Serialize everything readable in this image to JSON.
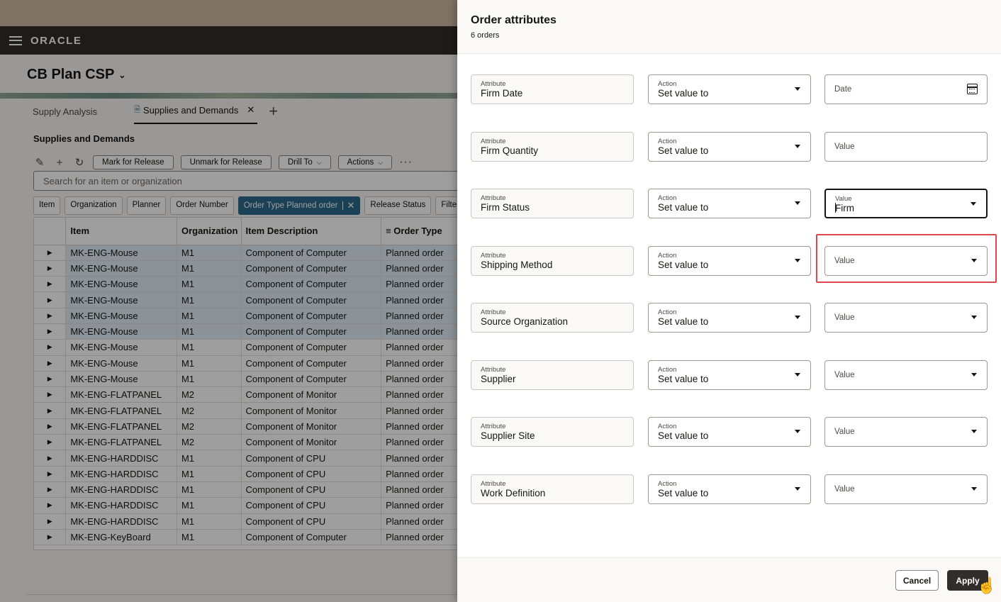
{
  "app": {
    "logo": "ORACLE",
    "page_title": "CB Plan CSP",
    "tabs": [
      {
        "label": "Supply Analysis"
      },
      {
        "label": "Supplies and Demands"
      }
    ],
    "section_title": "Supplies and Demands",
    "toolbar": {
      "mark_release": "Mark for Release",
      "unmark_release": "Unmark for Release",
      "drill_to": "Drill To",
      "actions": "Actions"
    },
    "search_placeholder": "Search for an item or organization",
    "chips": [
      "Item",
      "Organization",
      "Planner",
      "Order Number",
      "Order Type Planned order",
      "Release Status",
      "Filters"
    ],
    "table": {
      "columns": [
        "Item",
        "Organization",
        "Item Description",
        "Order Type"
      ],
      "rows": [
        [
          "MK-ENG-Mouse",
          "M1",
          "Component of Computer",
          "Planned order"
        ],
        [
          "MK-ENG-Mouse",
          "M1",
          "Component of Computer",
          "Planned order"
        ],
        [
          "MK-ENG-Mouse",
          "M1",
          "Component of Computer",
          "Planned order"
        ],
        [
          "MK-ENG-Mouse",
          "M1",
          "Component of Computer",
          "Planned order"
        ],
        [
          "MK-ENG-Mouse",
          "M1",
          "Component of Computer",
          "Planned order"
        ],
        [
          "MK-ENG-Mouse",
          "M1",
          "Component of Computer",
          "Planned order"
        ],
        [
          "MK-ENG-Mouse",
          "M1",
          "Component of Computer",
          "Planned order"
        ],
        [
          "MK-ENG-Mouse",
          "M1",
          "Component of Computer",
          "Planned order"
        ],
        [
          "MK-ENG-Mouse",
          "M1",
          "Component of Computer",
          "Planned order"
        ],
        [
          "MK-ENG-FLATPANEL",
          "M2",
          "Component of Monitor",
          "Planned order"
        ],
        [
          "MK-ENG-FLATPANEL",
          "M2",
          "Component of Monitor",
          "Planned order"
        ],
        [
          "MK-ENG-FLATPANEL",
          "M2",
          "Component of Monitor",
          "Planned order"
        ],
        [
          "MK-ENG-FLATPANEL",
          "M2",
          "Component of Monitor",
          "Planned order"
        ],
        [
          "MK-ENG-HARDDISC",
          "M1",
          "Component of CPU",
          "Planned order"
        ],
        [
          "MK-ENG-HARDDISC",
          "M1",
          "Component of CPU",
          "Planned order"
        ],
        [
          "MK-ENG-HARDDISC",
          "M1",
          "Component of CPU",
          "Planned order"
        ],
        [
          "MK-ENG-HARDDISC",
          "M1",
          "Component of CPU",
          "Planned order"
        ],
        [
          "MK-ENG-HARDDISC",
          "M1",
          "Component of CPU",
          "Planned order"
        ],
        [
          "MK-ENG-KeyBoard",
          "M1",
          "Component of Computer",
          "Planned order"
        ]
      ],
      "selected_rows": 6
    }
  },
  "drawer": {
    "title": "Order attributes",
    "subtitle": "6 orders",
    "attribute_label": "Attribute",
    "action_label": "Action",
    "value_label": "Value",
    "rows": [
      {
        "attribute": "Firm Date",
        "action": "Set value to",
        "value": "",
        "value_placeholder": "Date",
        "value_icon": "calendar-icon"
      },
      {
        "attribute": "Firm Quantity",
        "action": "Set value to",
        "value": "",
        "value_placeholder": "Value"
      },
      {
        "attribute": "Firm Status",
        "action": "Set value to",
        "value": "Firm",
        "value_placeholder": ""
      },
      {
        "attribute": "Shipping Method",
        "action": "Set value to",
        "value": "",
        "value_placeholder": "Value"
      },
      {
        "attribute": "Source Organization",
        "action": "Set value to",
        "value": "",
        "value_placeholder": "Value"
      },
      {
        "attribute": "Supplier",
        "action": "Set value to",
        "value": "",
        "value_placeholder": "Value"
      },
      {
        "attribute": "Supplier Site",
        "action": "Set value to",
        "value": "",
        "value_placeholder": "Value"
      },
      {
        "attribute": "Work Definition",
        "action": "Set value to",
        "value": "",
        "value_placeholder": "Value"
      }
    ],
    "cancel_label": "Cancel",
    "apply_label": "Apply"
  },
  "colors": {
    "brand_bar": "#312d2a",
    "highlight": "#e0474c",
    "selected_chip": "#2c6a8c"
  }
}
